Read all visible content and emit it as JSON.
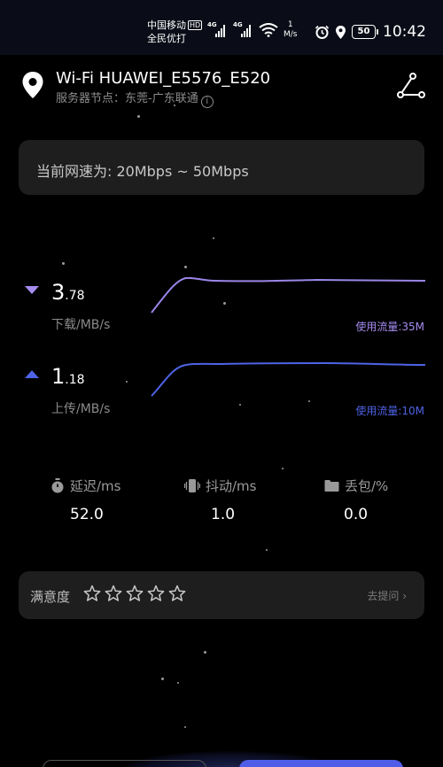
{
  "status_bar": {
    "carrier_line1": "中国移动",
    "hd_badge": "HD",
    "carrier_line2": "全民优打",
    "net_type_1": "4G",
    "net_type_2": "4G",
    "speed_value": "1",
    "speed_unit": "M/s",
    "battery": "50",
    "time": "10:42"
  },
  "header": {
    "network_name": "Wi-Fi HUAWEI_E5576_E520",
    "server_node": "服务器节点：东莞-广东联通"
  },
  "range": {
    "text": "当前网速为: 20Mbps ~ 50Mbps"
  },
  "download": {
    "value_int": "3",
    "value_dec": ".78",
    "unit": "下载/MB/s",
    "usage": "使用流量:35M",
    "color": "#a58cf0"
  },
  "upload": {
    "value_int": "1",
    "value_dec": ".18",
    "unit": "上传/MB/s",
    "usage": "使用流量:10M",
    "color": "#4e63e6"
  },
  "stats": {
    "latency_label": "延迟/ms",
    "latency_value": "52.0",
    "jitter_label": "抖动/ms",
    "jitter_value": "1.0",
    "loss_label": "丢包/%",
    "loss_value": "0.0"
  },
  "satisfaction": {
    "label": "满意度",
    "stars_filled": 0,
    "stars_total": 5,
    "link": "去提问 ›"
  }
}
